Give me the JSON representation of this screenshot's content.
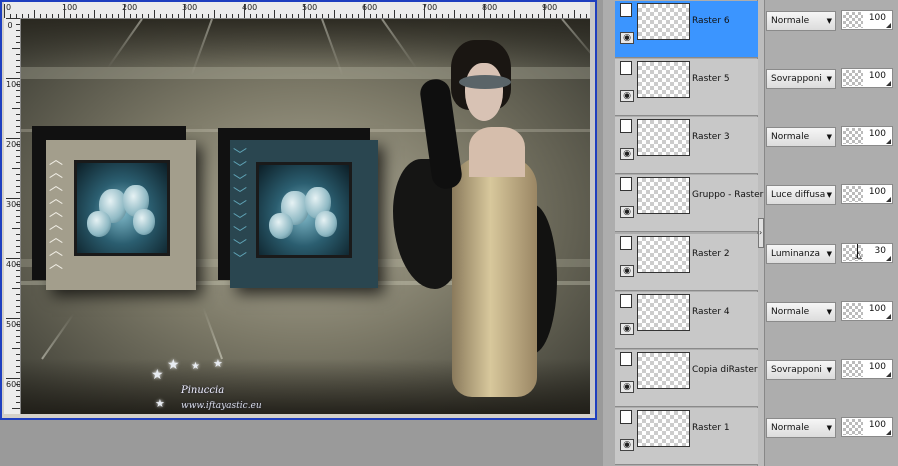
{
  "document": {
    "ruler_h_labels": [
      "0",
      "100",
      "200",
      "300",
      "400",
      "500",
      "600",
      "700",
      "800",
      "900"
    ],
    "ruler_v_labels": [
      "0",
      "100",
      "200",
      "300",
      "400",
      "500",
      "600"
    ]
  },
  "canvas": {
    "watermark_name": "Pinuccia",
    "watermark_url": "www.iftayastic.eu",
    "icons": [
      "chevron-up-icon",
      "chevron-down-icon",
      "star-icon"
    ]
  },
  "layers": [
    {
      "name": "Raster 6",
      "blend": "Normale",
      "opacity": "100",
      "selected": true
    },
    {
      "name": "Raster 5",
      "blend": "Sovrapponi",
      "opacity": "100",
      "selected": false
    },
    {
      "name": "Raster 3",
      "blend": "Normale",
      "opacity": "100",
      "selected": false
    },
    {
      "name": "Gruppo - Raster",
      "blend": "Luce diffusa",
      "opacity": "100",
      "selected": false
    },
    {
      "name": "Raster 2",
      "blend": "Luminanza",
      "opacity": "30",
      "selected": false
    },
    {
      "name": "Raster 4",
      "blend": "Normale",
      "opacity": "100",
      "selected": false
    },
    {
      "name": "Copia diRaster",
      "blend": "Sovrapponi",
      "opacity": "100",
      "selected": false
    },
    {
      "name": "Raster 1",
      "blend": "Normale",
      "opacity": "100",
      "selected": false
    }
  ],
  "colors": {
    "selection": "#3b95ff",
    "window_border": "#1f3fbf",
    "panel_bg": "#adadad"
  }
}
